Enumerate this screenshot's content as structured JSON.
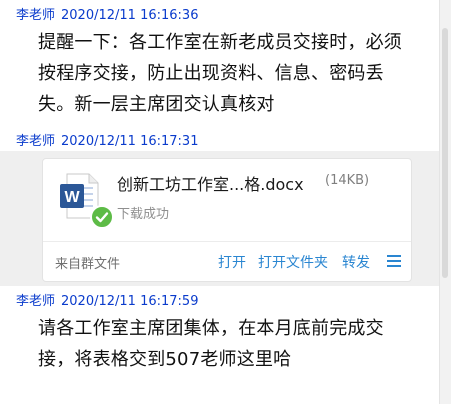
{
  "messages": [
    {
      "sender": "李老师",
      "datetime": "2020/12/11 16:16:36",
      "lines": [
        "提醒一下：各工作室在新老成员交接时，必须",
        "按程序交接，防止出现资料、信息、密码丢",
        "失。新一层主席团交认真核对"
      ]
    },
    {
      "sender": "李老师",
      "datetime": "2020/12/11 16:17:31",
      "file": {
        "name": "创新工坊工作室...格.docx",
        "size": "(14KB)",
        "status": "下载成功",
        "source": "来自群文件",
        "actions": [
          "打开",
          "打开文件夹",
          "转发"
        ],
        "icon": "word-doc-icon",
        "badge": "check-icon"
      }
    },
    {
      "sender": "李老师",
      "datetime": "2020/12/11 16:17:59",
      "lines": [
        "请各工作室主席团集体，在本月底前完成交",
        "接，将表格交到507老师这里哈"
      ]
    }
  ],
  "colors": {
    "sender": "#0a3bcc",
    "action": "#2a86d1",
    "band": "#efefef",
    "word": "#2b5797",
    "success": "#5dbb46"
  }
}
